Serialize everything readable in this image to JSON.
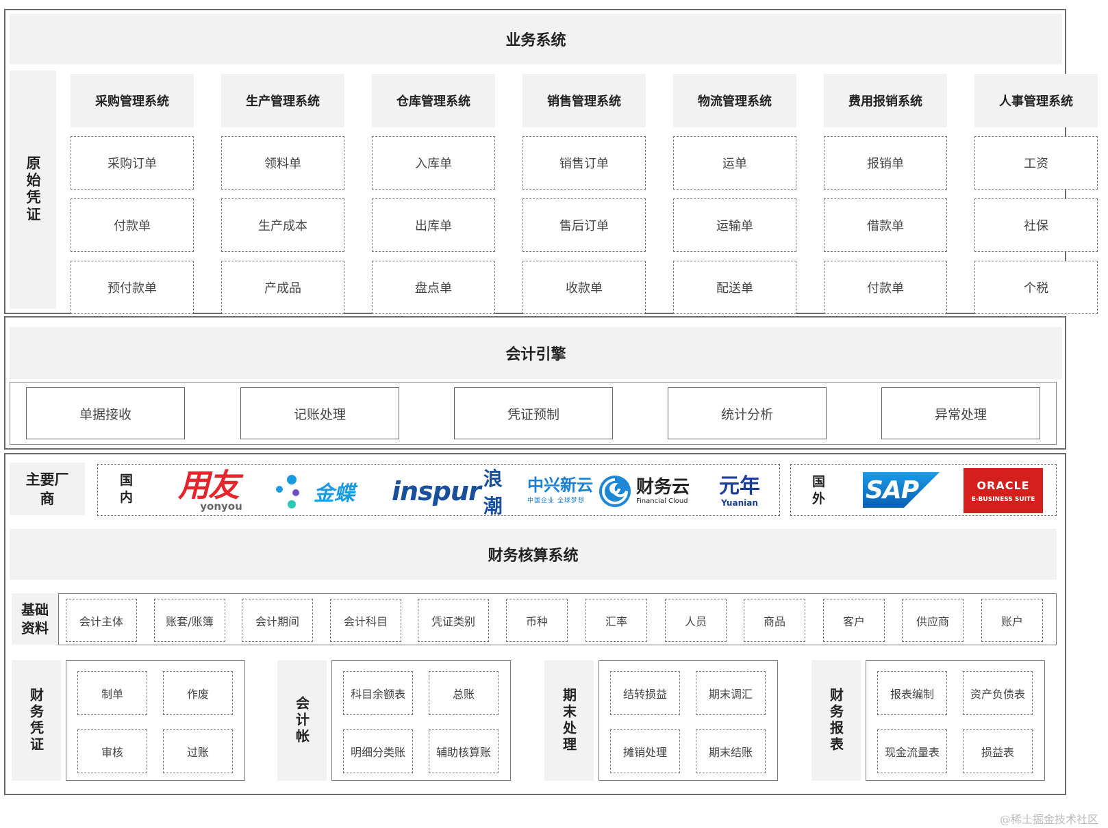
{
  "business": {
    "title": "业务系统",
    "side_label": "原始凭证",
    "systems": [
      {
        "name": "采购管理系统",
        "docs": [
          "采购订单",
          "付款单",
          "预付款单"
        ]
      },
      {
        "name": "生产管理系统",
        "docs": [
          "领料单",
          "生产成本",
          "产成品"
        ]
      },
      {
        "name": "仓库管理系统",
        "docs": [
          "入库单",
          "出库单",
          "盘点单"
        ]
      },
      {
        "name": "销售管理系统",
        "docs": [
          "销售订单",
          "售后订单",
          "收款单"
        ]
      },
      {
        "name": "物流管理系统",
        "docs": [
          "运单",
          "运输单",
          "配送单"
        ]
      },
      {
        "name": "费用报销系统",
        "docs": [
          "报销单",
          "借款单",
          "付款单"
        ]
      },
      {
        "name": "人事管理系统",
        "docs": [
          "工资",
          "社保",
          "个税"
        ]
      }
    ]
  },
  "engine": {
    "title": "会计引擎",
    "items": [
      "单据接收",
      "记账处理",
      "凭证预制",
      "统计分析",
      "异常处理"
    ]
  },
  "vendors": {
    "label": "主要厂商",
    "domestic_label": "国内",
    "foreign_label": "国外",
    "yonyou": {
      "text": "用友",
      "sub": "yonyou",
      "color": "#e5242b"
    },
    "kingdee": {
      "text": "金蝶",
      "color": "#1a9be0"
    },
    "inspur": {
      "text": "inspur",
      "cn": "浪潮",
      "color": "#1a4f9c"
    },
    "zte": {
      "text": "中兴新云",
      "sub": "中国企业 全球梦想",
      "color": "#1a7fd1"
    },
    "caiwuyun": {
      "text": "财务云",
      "sub": "Financial Cloud"
    },
    "yuanian": {
      "text": "元年",
      "sub": "Yuanian",
      "color": "#1a3d8f"
    },
    "sap": {
      "text": "SAP",
      "color": "#0a6fc2"
    },
    "oracle": {
      "text": "ORACLE",
      "sub": "E-BUSINESS SUITE",
      "color": "#d3201c"
    }
  },
  "finance": {
    "title": "财务核算系统",
    "basic_label": "基础资料",
    "basic_items": [
      "会计主体",
      "账套/账簿",
      "会计期间",
      "会计科目",
      "凭证类别",
      "币种",
      "汇率",
      "人员",
      "商品",
      "客户",
      "供应商",
      "账户"
    ],
    "modules": [
      {
        "label": "财务凭证",
        "items": [
          "制单",
          "作废",
          "审核",
          "过账"
        ]
      },
      {
        "label": "会计帐",
        "items": [
          "科目余额表",
          "总账",
          "明细分类账",
          "辅助核算账"
        ]
      },
      {
        "label": "期末处理",
        "items": [
          "结转损益",
          "期末调汇",
          "摊销处理",
          "期末结账"
        ]
      },
      {
        "label": "财务报表",
        "items": [
          "报表编制",
          "资产负债表",
          "现金流量表",
          "损益表"
        ]
      }
    ]
  },
  "watermark": "@稀土掘金技术社区"
}
